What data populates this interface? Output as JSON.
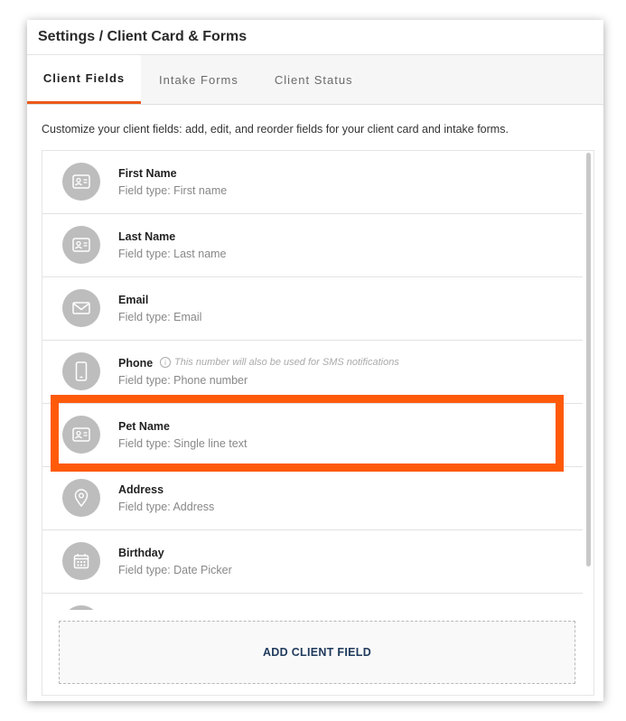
{
  "header": {
    "title": "Settings / Client Card & Forms"
  },
  "tabs": [
    {
      "label": "Client Fields",
      "active": true
    },
    {
      "label": "Intake Forms",
      "active": false
    },
    {
      "label": "Client Status",
      "active": false
    }
  ],
  "description": "Customize your client fields: add, edit, and reorder fields for your client card and intake forms.",
  "fields": [
    {
      "name": "First Name",
      "type": "Field type: First name",
      "icon": "id-card-icon"
    },
    {
      "name": "Last Name",
      "type": "Field type: Last name",
      "icon": "id-card-icon"
    },
    {
      "name": "Email",
      "type": "Field type: Email",
      "icon": "envelope-icon"
    },
    {
      "name": "Phone",
      "type": "Field type: Phone number",
      "icon": "phone-icon",
      "note": "This number will also be used for SMS notifications"
    },
    {
      "name": "Pet Name",
      "type": "Field type: Single line text",
      "icon": "id-card-icon",
      "highlighted": true
    },
    {
      "name": "Address",
      "type": "Field type: Address",
      "icon": "map-pin-icon"
    },
    {
      "name": "Birthday",
      "type": "Field type: Date Picker",
      "icon": "calendar-icon"
    }
  ],
  "add_button": {
    "label": "ADD CLIENT FIELD"
  },
  "colors": {
    "accent": "#ea5a1a",
    "highlight": "#ff5a0a",
    "icon_bg": "#bdbdbd",
    "button_text": "#1f3a5c"
  }
}
